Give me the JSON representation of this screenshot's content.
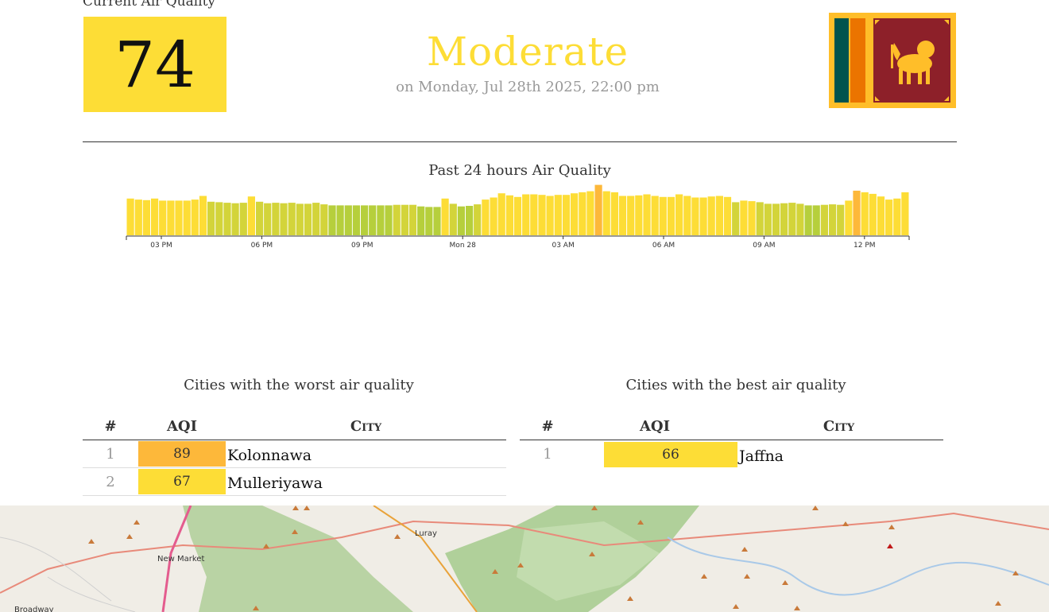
{
  "current": {
    "label": "Current Air Quality",
    "aqi": "74",
    "aqi_color": "#fddd36",
    "status": "Moderate",
    "timestamp": "on Monday, Jul 28th 2025, 22:00 pm"
  },
  "flag": {
    "icon": "sri-lanka-flag-icon"
  },
  "chart_data": {
    "type": "bar",
    "title": "Past 24 hours Air Quality",
    "x_ticks": [
      "03 PM",
      "06 PM",
      "09 PM",
      "Mon 28",
      "03 AM",
      "06 AM",
      "09 AM",
      "12 PM"
    ],
    "ylim": [
      0,
      100
    ],
    "values": [
      70,
      68,
      67,
      70,
      66,
      66,
      66,
      66,
      68,
      75,
      64,
      63,
      62,
      61,
      62,
      74,
      64,
      61,
      62,
      61,
      62,
      60,
      60,
      62,
      59,
      57,
      57,
      57,
      57,
      57,
      57,
      57,
      57,
      58,
      58,
      58,
      55,
      54,
      54,
      70,
      60,
      55,
      56,
      59,
      68,
      72,
      80,
      76,
      73,
      78,
      78,
      77,
      75,
      77,
      77,
      80,
      82,
      84,
      96,
      84,
      82,
      75,
      75,
      76,
      78,
      75,
      73,
      73,
      78,
      75,
      72,
      72,
      74,
      75,
      73,
      63,
      66,
      65,
      63,
      60,
      60,
      61,
      62,
      60,
      57,
      57,
      58,
      59,
      58,
      66,
      85,
      82,
      79,
      74,
      68,
      70,
      82
    ]
  },
  "worst": {
    "title": "Cities with the worst air quality",
    "headers": {
      "rank": "#",
      "aqi": "AQI",
      "city": "City"
    },
    "rows": [
      {
        "rank": "1",
        "aqi": "89",
        "city": "Kolonnawa",
        "color": "#fdb83a"
      },
      {
        "rank": "2",
        "aqi": "67",
        "city": "Mulleriyawa",
        "color": "#fddd36"
      }
    ]
  },
  "best": {
    "title": "Cities with the best air quality",
    "headers": {
      "rank": "#",
      "aqi": "AQI",
      "city": "City"
    },
    "rows": [
      {
        "rank": "1",
        "aqi": "66",
        "city": "Jaffna",
        "color": "#fddd36"
      }
    ]
  },
  "map": {
    "labels": [
      "Luray",
      "New Market",
      "Broadway"
    ]
  }
}
